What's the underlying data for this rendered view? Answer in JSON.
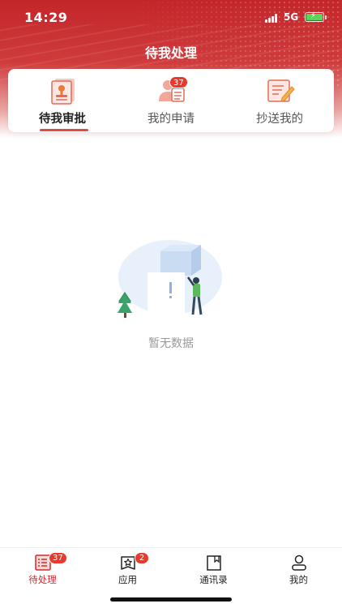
{
  "status_bar": {
    "time": "14:29",
    "network": "5G"
  },
  "header": {
    "title": "待我处理"
  },
  "tabs": [
    {
      "label": "待我审批",
      "icon": "approval-doc-icon",
      "active": true
    },
    {
      "label": "我的申请",
      "icon": "applicant-list-icon",
      "badge": "37"
    },
    {
      "label": "抄送我的",
      "icon": "cc-edit-icon"
    }
  ],
  "empty_state": {
    "text": "暂无数据",
    "icon": "empty-data-illustration"
  },
  "bottom_nav": [
    {
      "label": "待处理",
      "icon": "todo-list-icon",
      "badge": "37",
      "active": true
    },
    {
      "label": "应用",
      "icon": "apps-star-icon",
      "badge": "2"
    },
    {
      "label": "通讯录",
      "icon": "contacts-book-icon"
    },
    {
      "label": "我的",
      "icon": "profile-icon"
    }
  ],
  "colors": {
    "primary": "#d8262b",
    "badge": "#e8392c",
    "muted_text": "#999999"
  }
}
